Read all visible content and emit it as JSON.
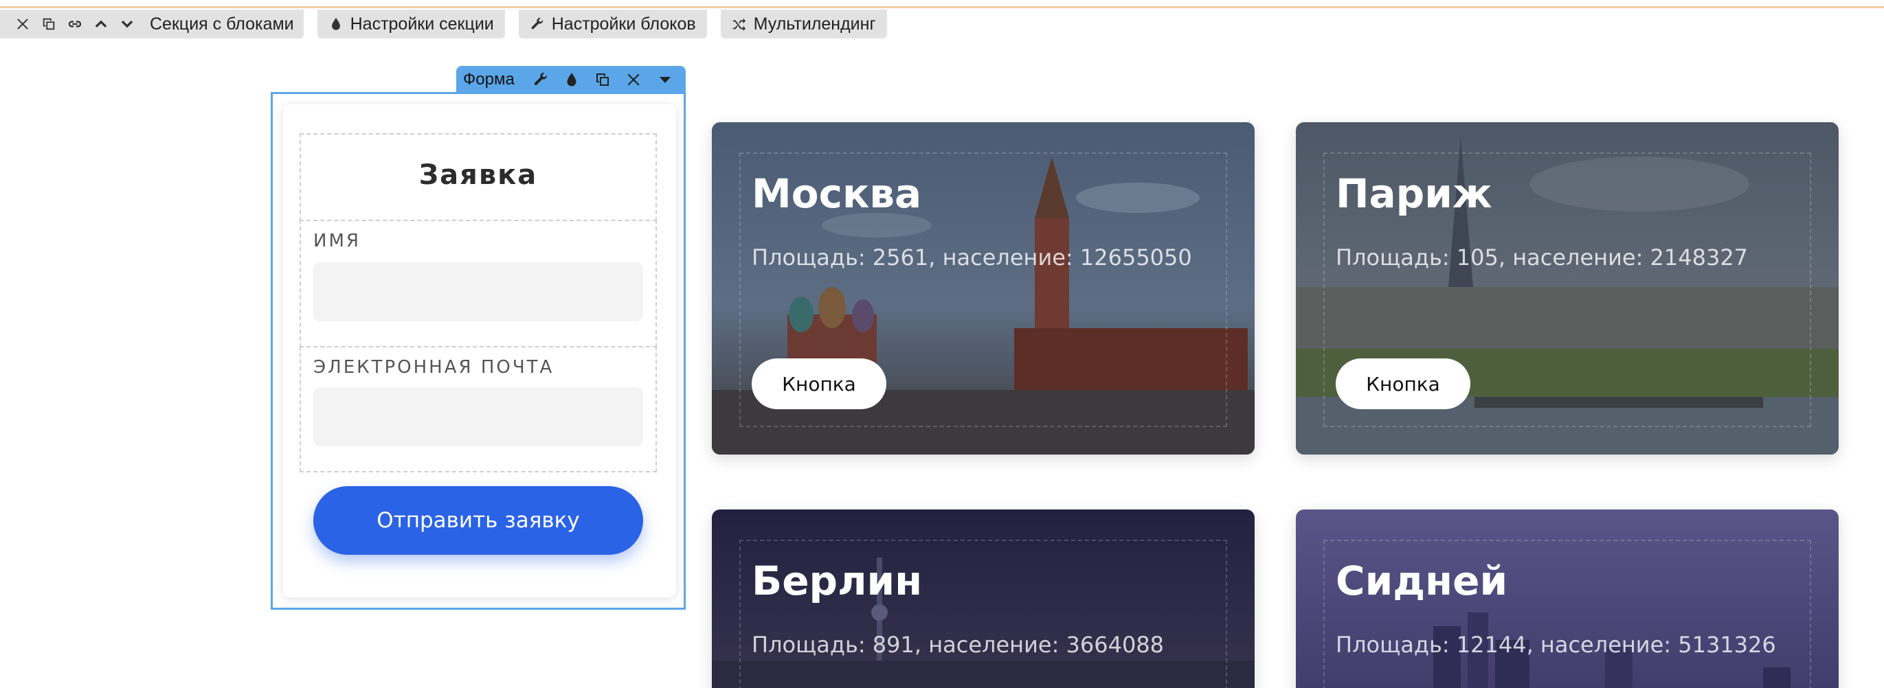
{
  "toolbar": {
    "section_label": "Секция с блоками",
    "section_settings": "Настройки секции",
    "block_settings": "Настройки блоков",
    "multilanding": "Мультилендинг"
  },
  "form_block": {
    "toolbar_label": "Форма",
    "title": "Заявка",
    "fields": [
      {
        "label": "ИМЯ",
        "value": ""
      },
      {
        "label": "ЭЛЕКТРОННАЯ ПОЧТА",
        "value": ""
      }
    ],
    "submit_label": "Отправить заявку"
  },
  "cards": [
    {
      "title": "Москва",
      "subtitle": "Площадь: 2561, население: 12655050",
      "button": "Кнопка"
    },
    {
      "title": "Париж",
      "subtitle": "Площадь: 105, население: 2148327",
      "button": "Кнопка"
    },
    {
      "title": "Берлин",
      "subtitle": "Площадь: 891, население: 3664088"
    },
    {
      "title": "Сидней",
      "subtitle": "Площадь: 12144, население: 5131326"
    }
  ],
  "colors": {
    "accent": "#2b63e6",
    "selection": "#5aa6e8",
    "toolbar_bg": "#e2e2e2"
  },
  "icons": [
    "close-icon",
    "copy-icon",
    "link-icon",
    "chevron-up-icon",
    "chevron-down-icon",
    "drop-icon",
    "wrench-icon",
    "shuffle-icon",
    "caret-down-icon"
  ]
}
